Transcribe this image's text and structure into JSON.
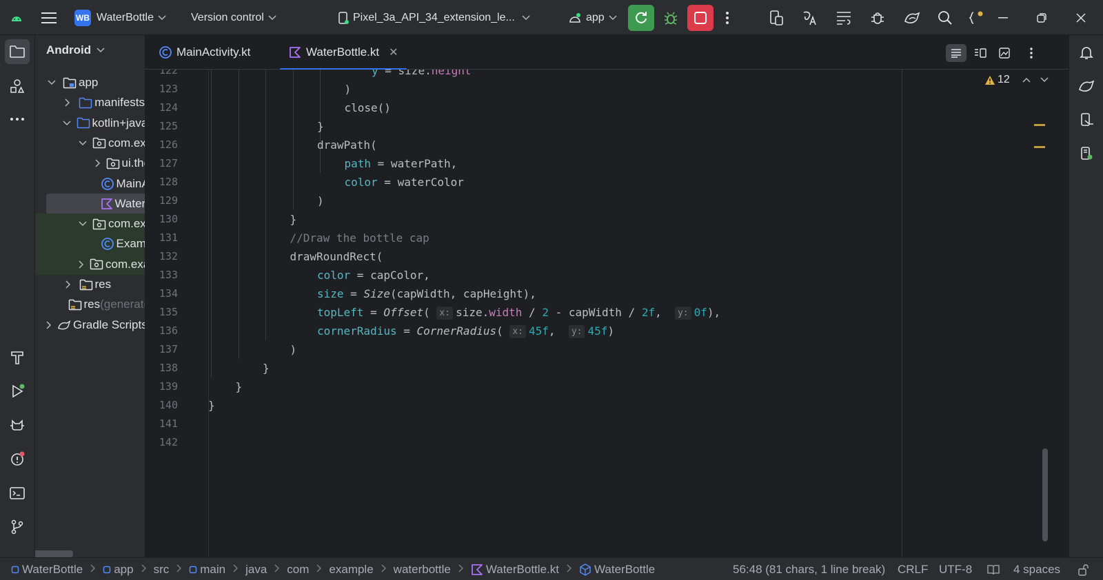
{
  "titlebar": {
    "project_badge": "WB",
    "project_name": "WaterBottle",
    "vcs_label": "Version control",
    "device_label": "Pixel_3a_API_34_extension_le...",
    "run_config": "app"
  },
  "project_panel": {
    "header": "Android",
    "tree": [
      {
        "label": "app",
        "indent": 0,
        "twisty": "down",
        "icon": "module"
      },
      {
        "label": "manifests",
        "indent": 1,
        "twisty": "right",
        "icon": "folder"
      },
      {
        "label": "kotlin+java",
        "indent": 1,
        "twisty": "down",
        "icon": "folder"
      },
      {
        "label": "com.example.waterbottle",
        "indent": 2,
        "twisty": "down",
        "icon": "package"
      },
      {
        "label": "ui.theme",
        "indent": 3,
        "twisty": "right",
        "icon": "package"
      },
      {
        "label": "MainActivity",
        "indent": 3,
        "twisty": "none",
        "icon": "kotlin-class"
      },
      {
        "label": "WaterBottle.kt",
        "indent": 3,
        "twisty": "none",
        "icon": "kotlin-file",
        "selected": true
      },
      {
        "label": "com.example.waterbottle",
        "indent": 2,
        "twisty": "down",
        "icon": "package",
        "test": true
      },
      {
        "label": "ExampleInstrumentedTest",
        "indent": 3,
        "twisty": "none",
        "icon": "kotlin-class",
        "test": true
      },
      {
        "label": "com.example.waterbottle",
        "indent": 2,
        "twisty": "right",
        "icon": "package",
        "test": true
      },
      {
        "label": "res",
        "indent": 1,
        "twisty": "right",
        "icon": "res-folder"
      },
      {
        "label": "res",
        "muted": " (generated)",
        "indent": 1,
        "twisty": "none",
        "icon": "res-folder"
      },
      {
        "label": "Gradle Scripts",
        "indent": 0,
        "twisty": "right",
        "icon": "gradle"
      }
    ]
  },
  "tabs": [
    {
      "label": "MainActivity.kt",
      "icon": "kotlin-class",
      "active": false
    },
    {
      "label": "WaterBottle.kt",
      "icon": "kotlin-file",
      "active": true
    }
  ],
  "editor": {
    "inspection_count": "12",
    "lines": [
      {
        "n": "122",
        "html": "<span class=\"c-named\">y</span> = size.<span class=\"c-prop\">height</span>",
        "indent": 6
      },
      {
        "n": "123",
        "html": ")",
        "indent": 5
      },
      {
        "n": "124",
        "html": "close()",
        "indent": 5
      },
      {
        "n": "125",
        "html": "}",
        "indent": 4
      },
      {
        "n": "126",
        "html": "drawPath(",
        "indent": 4
      },
      {
        "n": "127",
        "html": "<span class=\"c-named\">path</span> = waterPath,",
        "indent": 5
      },
      {
        "n": "128",
        "html": "<span class=\"c-named\">color</span> = waterColor",
        "indent": 5
      },
      {
        "n": "129",
        "html": ")",
        "indent": 4
      },
      {
        "n": "130",
        "html": "}",
        "indent": 3
      },
      {
        "n": "131",
        "html": "<span class=\"c-com\">//Draw the bottle cap</span>",
        "indent": 3
      },
      {
        "n": "132",
        "html": "drawRoundRect(",
        "indent": 3
      },
      {
        "n": "133",
        "html": "<span class=\"c-named\">color</span> = capColor,",
        "indent": 4
      },
      {
        "n": "134",
        "html": "<span class=\"c-named\">size</span> = <span class=\"c-italic\">Size</span>(capWidth, capHeight),",
        "indent": 4
      },
      {
        "n": "135",
        "html": "<span class=\"c-named\">topLeft</span> = <span class=\"c-italic\">Offset</span>( <span class=\"hint\">x:</span>size.<span class=\"c-prop\">width</span> / <span class=\"c-num\">2</span> - capWidth / <span class=\"c-num\">2f</span>,  <span class=\"hint\">y:</span><span class=\"c-num\">0f</span>),",
        "indent": 4
      },
      {
        "n": "136",
        "html": "<span class=\"c-named\">cornerRadius</span> = <span class=\"c-italic\">CornerRadius</span>( <span class=\"hint\">x:</span><span class=\"c-num\">45f</span>,  <span class=\"hint\">y:</span><span class=\"c-num\">45f</span>)",
        "indent": 4
      },
      {
        "n": "137",
        "html": ")",
        "indent": 3
      },
      {
        "n": "138",
        "html": "}",
        "indent": 2
      },
      {
        "n": "139",
        "html": "}",
        "indent": 1
      },
      {
        "n": "140",
        "html": "}",
        "indent": 0
      },
      {
        "n": "141",
        "html": "",
        "indent": 0
      },
      {
        "n": "142",
        "html": "",
        "indent": 0
      }
    ]
  },
  "statusbar": {
    "breadcrumbs": [
      {
        "label": "WaterBottle",
        "icon": "module"
      },
      {
        "label": "app",
        "icon": "module"
      },
      {
        "label": "src",
        "icon": "none"
      },
      {
        "label": "main",
        "icon": "module"
      },
      {
        "label": "java",
        "icon": "none"
      },
      {
        "label": "com",
        "icon": "none"
      },
      {
        "label": "example",
        "icon": "none"
      },
      {
        "label": "waterbottle",
        "icon": "none"
      },
      {
        "label": "WaterBottle.kt",
        "icon": "kotlin-file"
      },
      {
        "label": "WaterBottle",
        "icon": "composable"
      }
    ],
    "caret": "56:48 (81 chars, 1 line break)",
    "line_sep": "CRLF",
    "encoding": "UTF-8",
    "indent": "4 spaces"
  },
  "colors": {
    "accent": "#3574f0",
    "run_green": "#3d9a50",
    "stop_red": "#db3b4b",
    "warning": "#c29d3e",
    "kotlin_purple": "#a971f7"
  }
}
